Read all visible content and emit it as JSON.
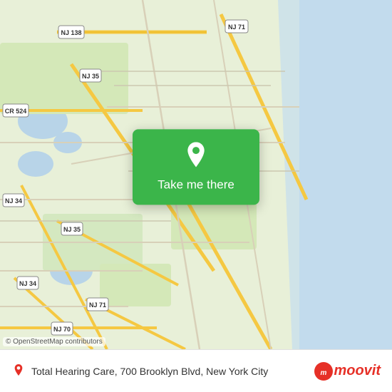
{
  "map": {
    "attribution": "© OpenStreetMap contributors",
    "background_color": "#e8f0d8"
  },
  "popup": {
    "label": "Take me there",
    "pin_color": "#ffffff"
  },
  "bottom_bar": {
    "location_text": "Total Hearing Care, 700 Brooklyn Blvd, New York City",
    "moovit_label": "moovit"
  },
  "road_labels": {
    "nj138": "NJ 138",
    "nj71_top": "NJ 71",
    "nj35_top": "NJ 35",
    "cr524": "CR 524",
    "nj34_mid": "NJ 34",
    "nj35_mid": "NJ 35",
    "nj71_mid": "NJ 71",
    "nj34_bot": "NJ 34",
    "nj71_bot": "NJ 71",
    "nj70": "NJ 70"
  }
}
